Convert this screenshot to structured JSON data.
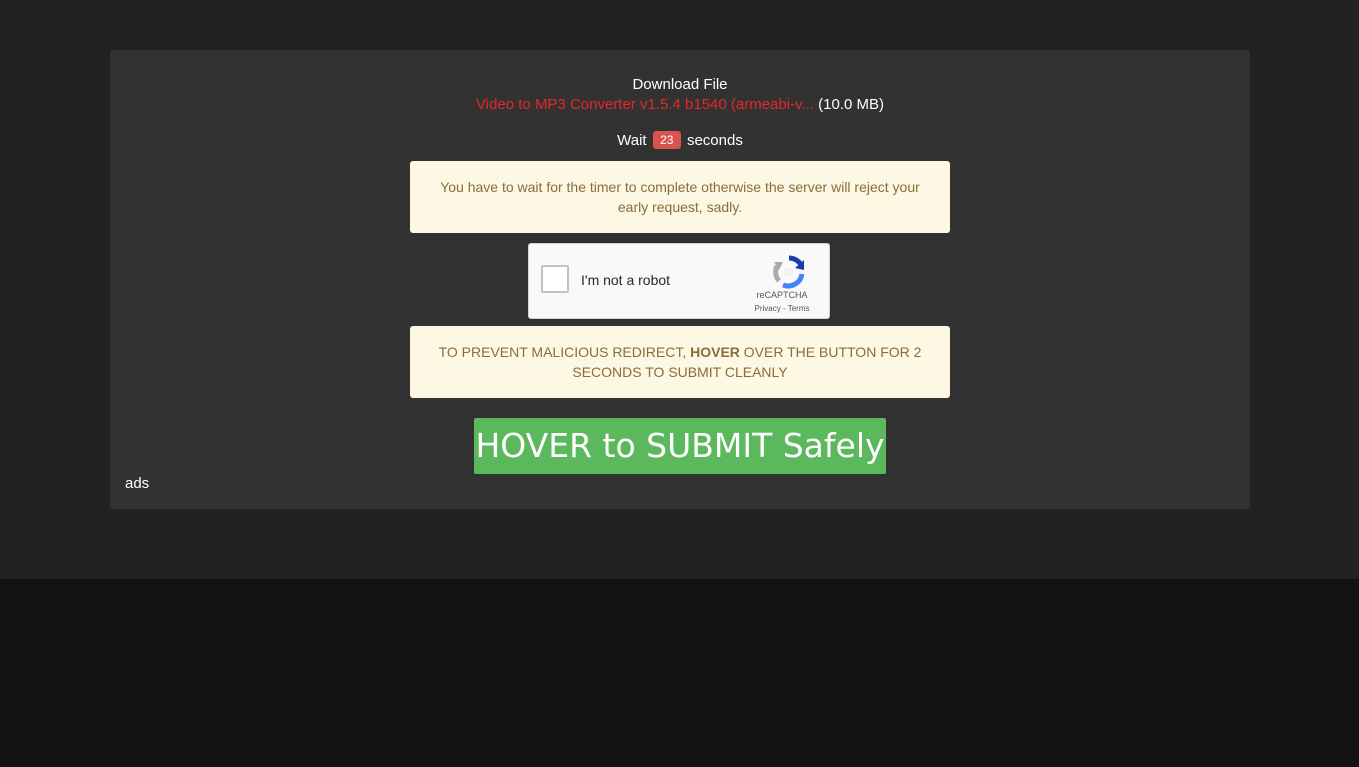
{
  "download": {
    "title": "Download File",
    "file_name": "Video to MP3 Converter v1.5.4 b1540 (armeabi-v...",
    "file_size": "(10.0 MB)"
  },
  "timer": {
    "prefix": "Wait",
    "seconds": "23",
    "suffix": "seconds"
  },
  "notices": {
    "wait_notice": "You have to wait for the timer to complete otherwise the server will reject your early request, sadly.",
    "hover_notice_before": "TO PREVENT MALICIOUS REDIRECT,",
    "hover_notice_bold": "HOVER",
    "hover_notice_after": "OVER THE BUTTON FOR 2 SECONDS TO SUBMIT CLEANLY"
  },
  "captcha": {
    "label": "I'm not a robot",
    "brand": "reCAPTCHA",
    "privacy": "Privacy",
    "separator": " - ",
    "terms": "Terms"
  },
  "submit_label": "HOVER to SUBMIT Safely",
  "ads_label": "ads",
  "colors": {
    "page_bg": "#222222",
    "card_bg": "#323232",
    "file_name": "#e8262a",
    "badge": "#d9534f",
    "notice_bg": "#fcf8e3",
    "notice_text": "#8a6d3b",
    "submit_bg": "#5cb85c"
  }
}
